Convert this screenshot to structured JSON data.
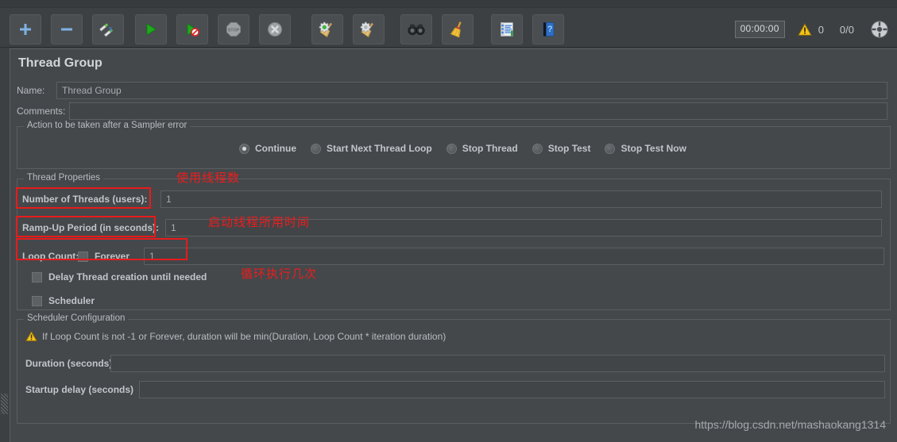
{
  "toolbar": {
    "buttons": [
      {
        "name": "add-button",
        "icon": "plus-icon",
        "label": "+"
      },
      {
        "name": "remove-button",
        "icon": "minus-icon",
        "label": "−"
      },
      {
        "name": "toggle-button",
        "icon": "toggle-pencil-icon",
        "label": ""
      },
      {
        "name": "start-button",
        "icon": "play-icon",
        "label": ""
      },
      {
        "name": "start-no-pauses-button",
        "icon": "play-no-pauses-icon",
        "label": ""
      },
      {
        "name": "stop-button",
        "icon": "stop-icon",
        "label": "STOP"
      },
      {
        "name": "shutdown-button",
        "icon": "shutdown-icon",
        "label": ""
      },
      {
        "name": "clear-button",
        "icon": "clear-broom-green-icon",
        "label": ""
      },
      {
        "name": "clear-all-button",
        "icon": "clear-broom-icon",
        "label": ""
      },
      {
        "name": "search-button",
        "icon": "binoculars-icon",
        "label": ""
      },
      {
        "name": "reset-search-button",
        "icon": "broom-icon",
        "label": ""
      },
      {
        "name": "function-helper-button",
        "icon": "notepad-icon",
        "label": ""
      },
      {
        "name": "help-button",
        "icon": "help-book-icon",
        "label": "?"
      }
    ],
    "status": {
      "timer": "00:00:00",
      "warning_icon": "warning-triangle-icon",
      "warning_count": "0",
      "threads_running": "0/0",
      "remote_icon": "remote-engines-icon"
    }
  },
  "panel": {
    "title": "Thread Group",
    "name_label": "Name:",
    "name_value": "Thread Group",
    "comments_label": "Comments:",
    "comments_value": ""
  },
  "sampler_error": {
    "group_title": "Action to be taken after a Sampler error",
    "options": [
      {
        "label": "Continue",
        "checked": true
      },
      {
        "label": "Start Next Thread Loop",
        "checked": false
      },
      {
        "label": "Stop Thread",
        "checked": false
      },
      {
        "label": "Stop Test",
        "checked": false
      },
      {
        "label": "Stop Test Now",
        "checked": false
      }
    ]
  },
  "thread_properties": {
    "group_title": "Thread Properties",
    "num_threads_label": "Number of Threads (users):",
    "num_threads_value": "1",
    "ramp_up_label": "Ramp-Up Period (in seconds):",
    "ramp_up_value": "1",
    "loop_count_label": "Loop Count:",
    "forever_label": "Forever",
    "forever_checked": false,
    "loop_count_value": "1",
    "delay_thread_label": "Delay Thread creation until needed",
    "delay_thread_checked": false,
    "scheduler_label": "Scheduler",
    "scheduler_checked": false
  },
  "scheduler_config": {
    "group_title": "Scheduler Configuration",
    "warning_icon": "warning-triangle-icon",
    "warning_text": "If Loop Count is not -1 or Forever, duration will be min(Duration, Loop Count * iteration duration)",
    "duration_label": "Duration (seconds)",
    "duration_value": "",
    "startup_delay_label": "Startup delay (seconds)",
    "startup_delay_value": ""
  },
  "annotations": {
    "note_threads": "使用线程数",
    "note_rampup": "启动线程所用时间",
    "note_loop": "循环执行几次",
    "color": "#ef1c1c"
  },
  "watermark": "https://blog.csdn.net/mashaokang1314"
}
